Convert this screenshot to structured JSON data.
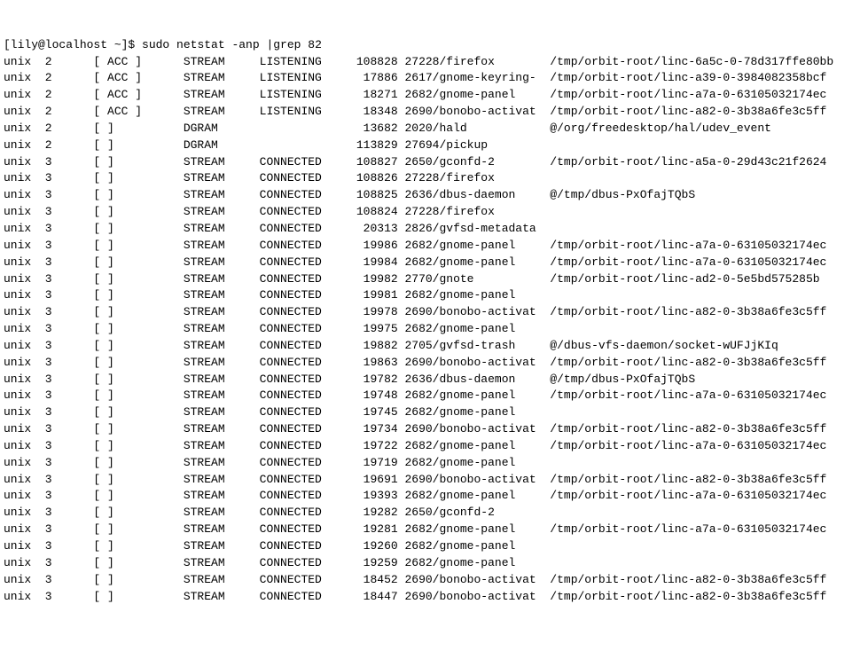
{
  "prompt": "[lily@localhost ~]$ ",
  "command": "sudo netstat -anp |grep 82",
  "rows": [
    {
      "proto": "unix",
      "refcnt": "2",
      "flags": "[ ACC ]",
      "type": "STREAM",
      "state": "LISTENING",
      "inode": "108828",
      "prog": "27228/firefox",
      "path": "/tmp/orbit-root/linc-6a5c-0-78d317ffe80bb"
    },
    {
      "proto": "unix",
      "refcnt": "2",
      "flags": "[ ACC ]",
      "type": "STREAM",
      "state": "LISTENING",
      "inode": "17886",
      "prog": "2617/gnome-keyring-",
      "path": "/tmp/orbit-root/linc-a39-0-3984082358bcf"
    },
    {
      "proto": "unix",
      "refcnt": "2",
      "flags": "[ ACC ]",
      "type": "STREAM",
      "state": "LISTENING",
      "inode": "18271",
      "prog": "2682/gnome-panel",
      "path": "/tmp/orbit-root/linc-a7a-0-63105032174ec"
    },
    {
      "proto": "unix",
      "refcnt": "2",
      "flags": "[ ACC ]",
      "type": "STREAM",
      "state": "LISTENING",
      "inode": "18348",
      "prog": "2690/bonobo-activat",
      "path": "/tmp/orbit-root/linc-a82-0-3b38a6fe3c5ff"
    },
    {
      "proto": "unix",
      "refcnt": "2",
      "flags": "[ ]",
      "type": "DGRAM",
      "state": "",
      "inode": "13682",
      "prog": "2020/hald",
      "path": "@/org/freedesktop/hal/udev_event"
    },
    {
      "proto": "unix",
      "refcnt": "2",
      "flags": "[ ]",
      "type": "DGRAM",
      "state": "",
      "inode": "113829",
      "prog": "27694/pickup",
      "path": ""
    },
    {
      "proto": "unix",
      "refcnt": "3",
      "flags": "[ ]",
      "type": "STREAM",
      "state": "CONNECTED",
      "inode": "108827",
      "prog": "2650/gconfd-2",
      "path": "/tmp/orbit-root/linc-a5a-0-29d43c21f2624"
    },
    {
      "proto": "unix",
      "refcnt": "3",
      "flags": "[ ]",
      "type": "STREAM",
      "state": "CONNECTED",
      "inode": "108826",
      "prog": "27228/firefox",
      "path": ""
    },
    {
      "proto": "unix",
      "refcnt": "3",
      "flags": "[ ]",
      "type": "STREAM",
      "state": "CONNECTED",
      "inode": "108825",
      "prog": "2636/dbus-daemon",
      "path": "@/tmp/dbus-PxOfajTQbS"
    },
    {
      "proto": "unix",
      "refcnt": "3",
      "flags": "[ ]",
      "type": "STREAM",
      "state": "CONNECTED",
      "inode": "108824",
      "prog": "27228/firefox",
      "path": ""
    },
    {
      "proto": "unix",
      "refcnt": "3",
      "flags": "[ ]",
      "type": "STREAM",
      "state": "CONNECTED",
      "inode": "20313",
      "prog": "2826/gvfsd-metadata",
      "path": ""
    },
    {
      "proto": "unix",
      "refcnt": "3",
      "flags": "[ ]",
      "type": "STREAM",
      "state": "CONNECTED",
      "inode": "19986",
      "prog": "2682/gnome-panel",
      "path": "/tmp/orbit-root/linc-a7a-0-63105032174ec"
    },
    {
      "proto": "unix",
      "refcnt": "3",
      "flags": "[ ]",
      "type": "STREAM",
      "state": "CONNECTED",
      "inode": "19984",
      "prog": "2682/gnome-panel",
      "path": "/tmp/orbit-root/linc-a7a-0-63105032174ec"
    },
    {
      "proto": "unix",
      "refcnt": "3",
      "flags": "[ ]",
      "type": "STREAM",
      "state": "CONNECTED",
      "inode": "19982",
      "prog": "2770/gnote",
      "path": "/tmp/orbit-root/linc-ad2-0-5e5bd575285b"
    },
    {
      "proto": "unix",
      "refcnt": "3",
      "flags": "[ ]",
      "type": "STREAM",
      "state": "CONNECTED",
      "inode": "19981",
      "prog": "2682/gnome-panel",
      "path": ""
    },
    {
      "proto": "unix",
      "refcnt": "3",
      "flags": "[ ]",
      "type": "STREAM",
      "state": "CONNECTED",
      "inode": "19978",
      "prog": "2690/bonobo-activat",
      "path": "/tmp/orbit-root/linc-a82-0-3b38a6fe3c5ff"
    },
    {
      "proto": "unix",
      "refcnt": "3",
      "flags": "[ ]",
      "type": "STREAM",
      "state": "CONNECTED",
      "inode": "19975",
      "prog": "2682/gnome-panel",
      "path": ""
    },
    {
      "proto": "unix",
      "refcnt": "3",
      "flags": "[ ]",
      "type": "STREAM",
      "state": "CONNECTED",
      "inode": "19882",
      "prog": "2705/gvfsd-trash",
      "path": "@/dbus-vfs-daemon/socket-wUFJjKIq"
    },
    {
      "proto": "unix",
      "refcnt": "3",
      "flags": "[ ]",
      "type": "STREAM",
      "state": "CONNECTED",
      "inode": "19863",
      "prog": "2690/bonobo-activat",
      "path": "/tmp/orbit-root/linc-a82-0-3b38a6fe3c5ff"
    },
    {
      "proto": "unix",
      "refcnt": "3",
      "flags": "[ ]",
      "type": "STREAM",
      "state": "CONNECTED",
      "inode": "19782",
      "prog": "2636/dbus-daemon",
      "path": "@/tmp/dbus-PxOfajTQbS"
    },
    {
      "proto": "unix",
      "refcnt": "3",
      "flags": "[ ]",
      "type": "STREAM",
      "state": "CONNECTED",
      "inode": "19748",
      "prog": "2682/gnome-panel",
      "path": "/tmp/orbit-root/linc-a7a-0-63105032174ec"
    },
    {
      "proto": "unix",
      "refcnt": "3",
      "flags": "[ ]",
      "type": "STREAM",
      "state": "CONNECTED",
      "inode": "19745",
      "prog": "2682/gnome-panel",
      "path": ""
    },
    {
      "proto": "unix",
      "refcnt": "3",
      "flags": "[ ]",
      "type": "STREAM",
      "state": "CONNECTED",
      "inode": "19734",
      "prog": "2690/bonobo-activat",
      "path": "/tmp/orbit-root/linc-a82-0-3b38a6fe3c5ff"
    },
    {
      "proto": "unix",
      "refcnt": "3",
      "flags": "[ ]",
      "type": "STREAM",
      "state": "CONNECTED",
      "inode": "19722",
      "prog": "2682/gnome-panel",
      "path": "/tmp/orbit-root/linc-a7a-0-63105032174ec"
    },
    {
      "proto": "unix",
      "refcnt": "3",
      "flags": "[ ]",
      "type": "STREAM",
      "state": "CONNECTED",
      "inode": "19719",
      "prog": "2682/gnome-panel",
      "path": ""
    },
    {
      "proto": "unix",
      "refcnt": "3",
      "flags": "[ ]",
      "type": "STREAM",
      "state": "CONNECTED",
      "inode": "19691",
      "prog": "2690/bonobo-activat",
      "path": "/tmp/orbit-root/linc-a82-0-3b38a6fe3c5ff"
    },
    {
      "proto": "unix",
      "refcnt": "3",
      "flags": "[ ]",
      "type": "STREAM",
      "state": "CONNECTED",
      "inode": "19393",
      "prog": "2682/gnome-panel",
      "path": "/tmp/orbit-root/linc-a7a-0-63105032174ec"
    },
    {
      "proto": "unix",
      "refcnt": "3",
      "flags": "[ ]",
      "type": "STREAM",
      "state": "CONNECTED",
      "inode": "19282",
      "prog": "2650/gconfd-2",
      "path": ""
    },
    {
      "proto": "unix",
      "refcnt": "3",
      "flags": "[ ]",
      "type": "STREAM",
      "state": "CONNECTED",
      "inode": "19281",
      "prog": "2682/gnome-panel",
      "path": "/tmp/orbit-root/linc-a7a-0-63105032174ec"
    },
    {
      "proto": "unix",
      "refcnt": "3",
      "flags": "[ ]",
      "type": "STREAM",
      "state": "CONNECTED",
      "inode": "19260",
      "prog": "2682/gnome-panel",
      "path": ""
    },
    {
      "proto": "unix",
      "refcnt": "3",
      "flags": "[ ]",
      "type": "STREAM",
      "state": "CONNECTED",
      "inode": "19259",
      "prog": "2682/gnome-panel",
      "path": ""
    },
    {
      "proto": "unix",
      "refcnt": "3",
      "flags": "[ ]",
      "type": "STREAM",
      "state": "CONNECTED",
      "inode": "18452",
      "prog": "2690/bonobo-activat",
      "path": "/tmp/orbit-root/linc-a82-0-3b38a6fe3c5ff"
    },
    {
      "proto": "unix",
      "refcnt": "3",
      "flags": "[ ]",
      "type": "STREAM",
      "state": "CONNECTED",
      "inode": "18447",
      "prog": "2690/bonobo-activat",
      "path": "/tmp/orbit-root/linc-a82-0-3b38a6fe3c5ff"
    }
  ]
}
